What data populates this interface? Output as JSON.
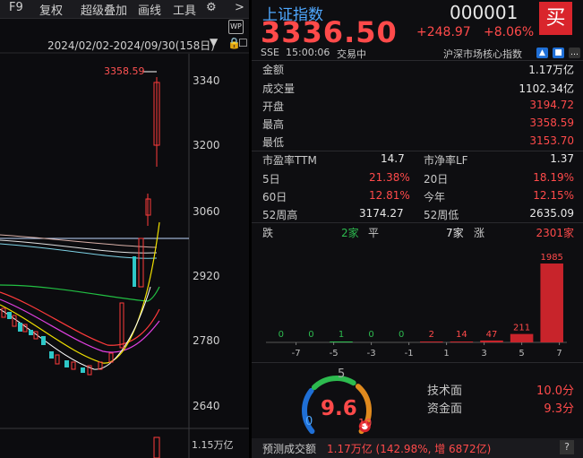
{
  "toolbar": {
    "f9": "F9",
    "fuquan": "复权",
    "overlay": "超级叠加",
    "draw": "画线",
    "tools": "工具",
    "more": ">"
  },
  "chart": {
    "date_range": "2024/02/02-2024/09/30(158日)",
    "high_label": "3358.59",
    "y_ticks": [
      "3340",
      "3200",
      "3060",
      "2920",
      "2780",
      "2640"
    ],
    "volume_label": "1.15万亿"
  },
  "quote": {
    "name": "上证指数",
    "code": "000001",
    "buy": "买",
    "price": "3336.50",
    "change": "+248.97",
    "change_pct": "+8.06%",
    "exchange": "SSE",
    "time": "15:00:06",
    "status": "交易中",
    "category": "沪深市场核心指数"
  },
  "stats": [
    {
      "label": "金额",
      "value": "1.17万亿",
      "color": "white"
    },
    {
      "label": "成交量",
      "value": "1102.34亿",
      "color": "white"
    },
    {
      "label": "开盘",
      "value": "3194.72",
      "color": "red"
    },
    {
      "label": "最高",
      "value": "3358.59",
      "color": "red"
    },
    {
      "label": "最低",
      "value": "3153.70",
      "color": "red"
    }
  ],
  "metrics": {
    "pe_label": "市盈率TTM",
    "pe_value": "14.7",
    "pb_label": "市净率LF",
    "pb_value": "1.37",
    "d5_label": "5日",
    "d5_value": "21.38%",
    "d20_label": "20日",
    "d20_value": "18.19%",
    "d60_label": "60日",
    "d60_value": "12.81%",
    "ytd_label": "今年",
    "ytd_value": "12.15%",
    "w52h_label": "52周高",
    "w52h_value": "3174.27",
    "w52l_label": "52周低",
    "w52l_value": "2635.09"
  },
  "breadth": {
    "down_label": "跌",
    "down_value": "2家",
    "flat_label": "平",
    "flat_value": "7家",
    "up_label": "涨",
    "up_value": "2301家"
  },
  "chart_data": {
    "type": "bar",
    "categories": [
      "-7",
      "-5",
      "-3",
      "-1",
      "1",
      "3",
      "5",
      "7"
    ],
    "bin_labels": [
      "-7",
      "-5",
      "-3",
      "-1",
      "1",
      "3",
      "5",
      "7"
    ],
    "values": [
      0,
      0,
      1,
      0,
      0,
      2,
      14,
      47,
      211,
      1985
    ],
    "value_labels": [
      "0",
      "0",
      "1",
      "0",
      "0",
      "2",
      "14",
      "47",
      "211",
      "1985"
    ],
    "colors": {
      "down": "#2dbb4f",
      "up": "#c8242b"
    }
  },
  "gauge": {
    "value": "9.6",
    "min": "0",
    "mid": "5",
    "max": "10",
    "score": 9.6
  },
  "scores": {
    "tech_label": "技术面",
    "tech_value": "10.0分",
    "fund_label": "资金面",
    "fund_value": "9.3分"
  },
  "forecast": {
    "label": "预测成交额",
    "value": "1.17万亿 (142.98%, 增 6872亿)",
    "help": "?"
  },
  "colors": {
    "red": "#ff4a4a",
    "green": "#2dbb4f",
    "accent_blue": "#1f6fd6",
    "bg": "#0e0e11"
  }
}
